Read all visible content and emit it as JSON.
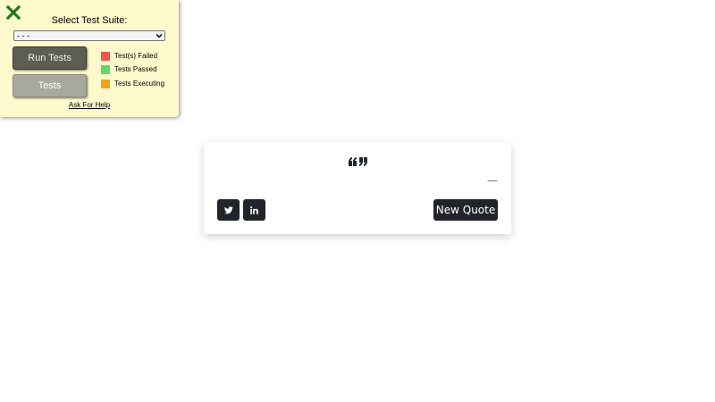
{
  "test_panel": {
    "title": "Select Test Suite:",
    "suite_select_value": "- - -",
    "run_tests_label": "Run Tests",
    "tests_label": "Tests",
    "legend": [
      {
        "label": "Test(s) Failed",
        "color": "#f0574a"
      },
      {
        "label": "Tests Passed",
        "color": "#64d66a"
      },
      {
        "label": "Tests Executing",
        "color": "#f5a01a"
      }
    ],
    "help_link": "Ask For Help",
    "close_icon_color": "#1f7a1f"
  },
  "quote_box": {
    "quote_icon": "quote-left-icon",
    "text": "",
    "author_prefix": "—",
    "twitter_icon": "twitter-icon",
    "linkedin_icon": "linkedin-icon",
    "new_quote_label": "New Quote",
    "accent_color": "#212529"
  }
}
